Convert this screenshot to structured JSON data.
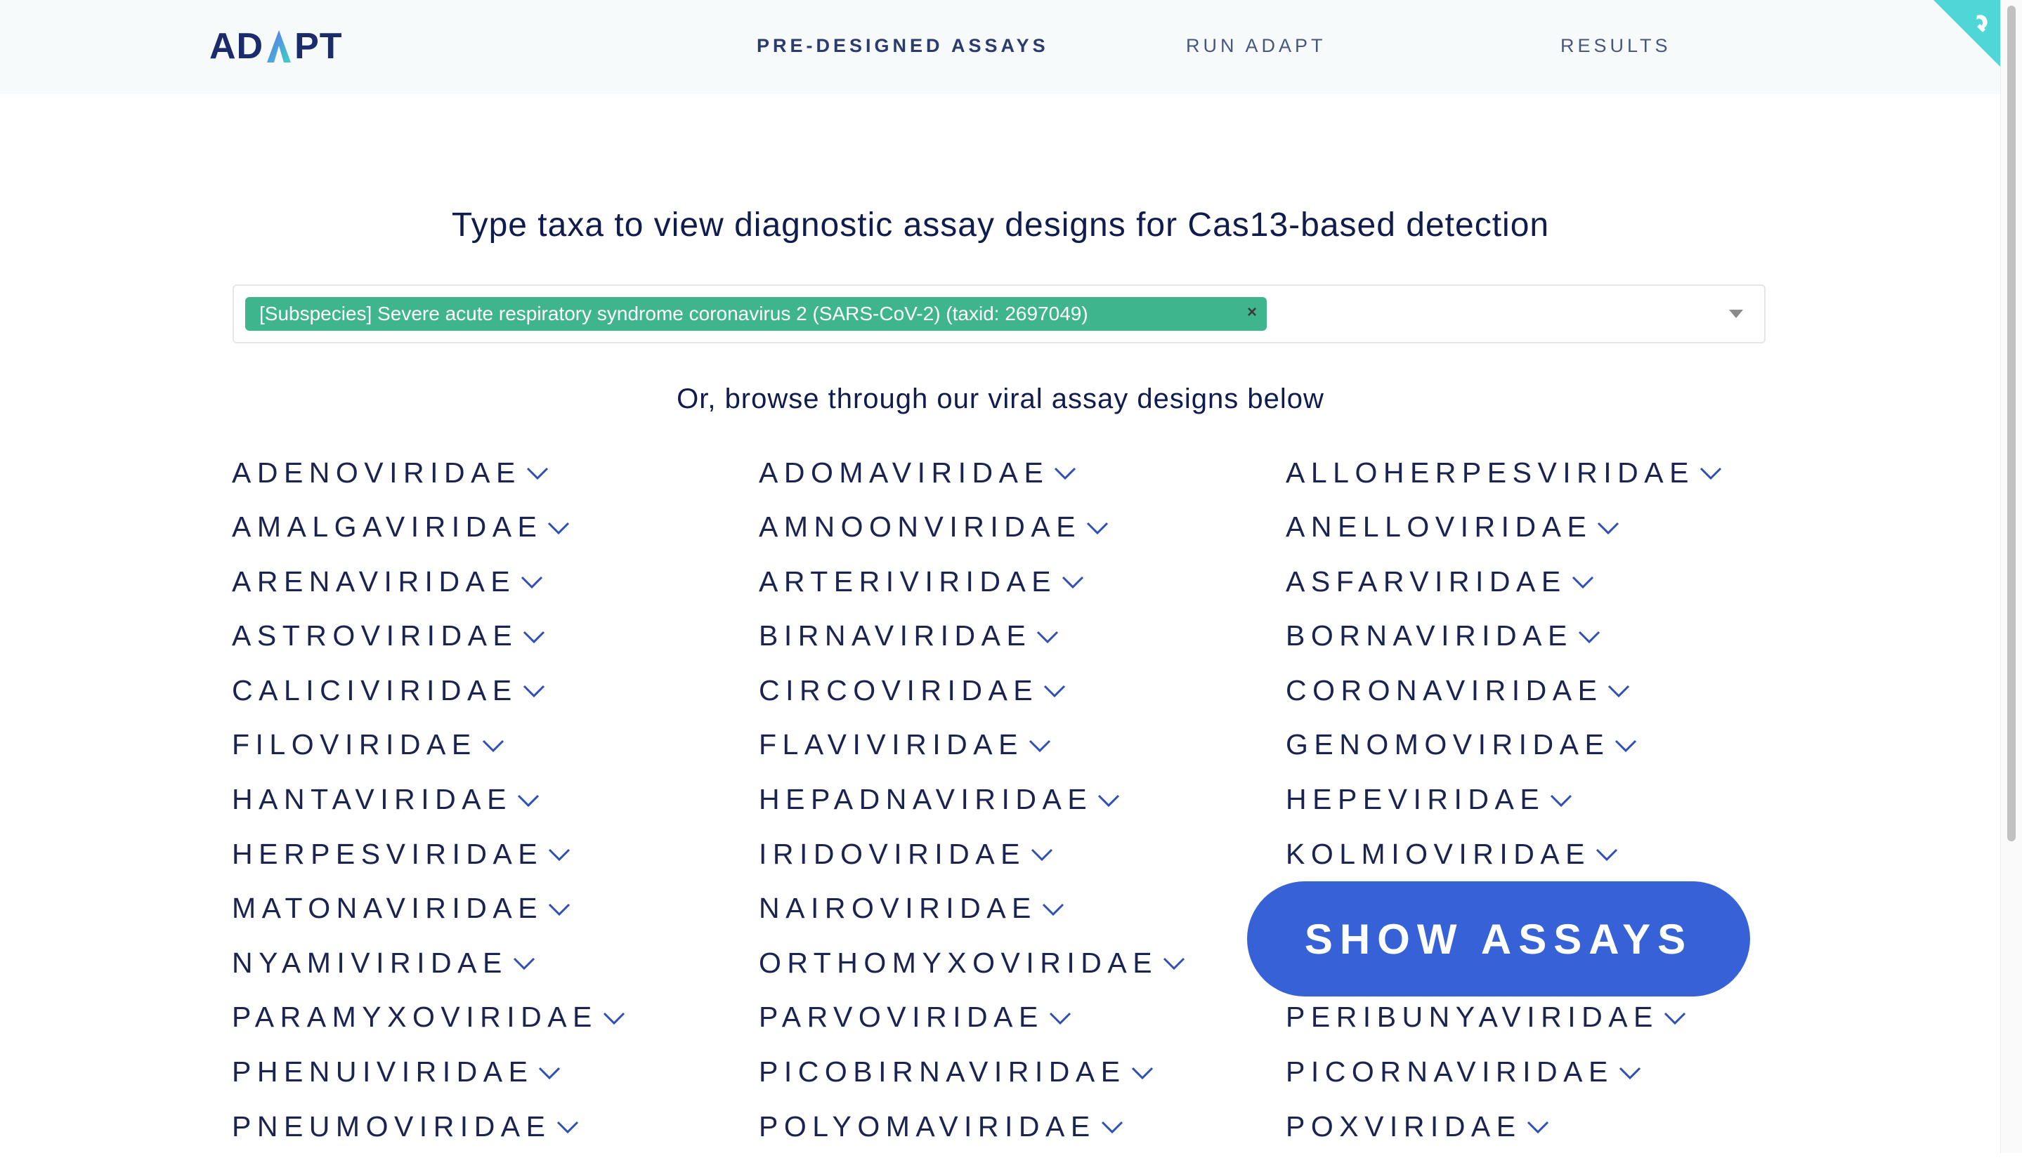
{
  "brand": {
    "logo_text_left": "AD",
    "logo_text_right": "PT"
  },
  "nav": {
    "items": [
      {
        "label": "PRE-DESIGNED ASSAYS",
        "active": true
      },
      {
        "label": "RUN ADAPT",
        "active": false
      },
      {
        "label": "RESULTS",
        "active": false
      }
    ]
  },
  "headline": "Type taxa to view diagnostic assay designs for Cas13-based detection",
  "search": {
    "selected_tag": "[Subspecies] Severe acute respiratory syndrome coronavirus 2 (SARS-CoV-2) (taxid: 2697049)",
    "remove_symbol": "×"
  },
  "subhead": "Or, browse through our viral assay designs below",
  "families": [
    "ADENOVIRIDAE",
    "ADOMAVIRIDAE",
    "ALLOHERPESVIRIDAE",
    "AMALGAVIRIDAE",
    "AMNOONVIRIDAE",
    "ANELLOVIRIDAE",
    "ARENAVIRIDAE",
    "ARTERIVIRIDAE",
    "ASFARVIRIDAE",
    "ASTROVIRIDAE",
    "BIRNAVIRIDAE",
    "BORNAVIRIDAE",
    "CALICIVIRIDAE",
    "CIRCOVIRIDAE",
    "CORONAVIRIDAE",
    "FILOVIRIDAE",
    "FLAVIVIRIDAE",
    "GENOMOVIRIDAE",
    "HANTAVIRIDAE",
    "HEPADNAVIRIDAE",
    "HEPEVIRIDAE",
    "HERPESVIRIDAE",
    "IRIDOVIRIDAE",
    "KOLMIOVIRIDAE",
    "MATONAVIRIDAE",
    "NAIROVIRIDAE",
    "",
    "NYAMIVIRIDAE",
    "ORTHOMYXOVIRIDAE",
    "",
    "PARAMYXOVIRIDAE",
    "PARVOVIRIDAE",
    "PERIBUNYAVIRIDAE",
    "PHENUIVIRIDAE",
    "PICOBIRNAVIRIDAE",
    "PICORNAVIRIDAE",
    "PNEUMOVIRIDAE",
    "POLYOMAVIRIDAE",
    "POXVIRIDAE"
  ],
  "show_button_label": "SHOW ASSAYS",
  "colors": {
    "accent": "#3762d7",
    "tag_green": "#3fb58d",
    "corner_teal": "#4fd6d6",
    "text_navy": "#1b2450"
  }
}
